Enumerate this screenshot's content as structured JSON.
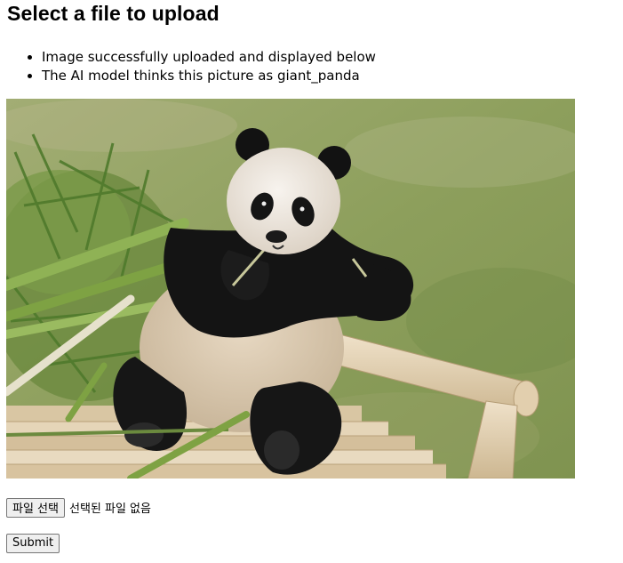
{
  "page": {
    "heading": "Select a file to upload"
  },
  "messages": [
    "Image successfully uploaded and displayed below",
    "The AI model thinks this picture as giant_panda"
  ],
  "image": {
    "subject": "giant panda sitting on wooden logs eating bamboo"
  },
  "file_input": {
    "button_label": "파일 선택",
    "status_text": "선택된 파일 없음"
  },
  "form": {
    "submit_label": "Submit"
  }
}
